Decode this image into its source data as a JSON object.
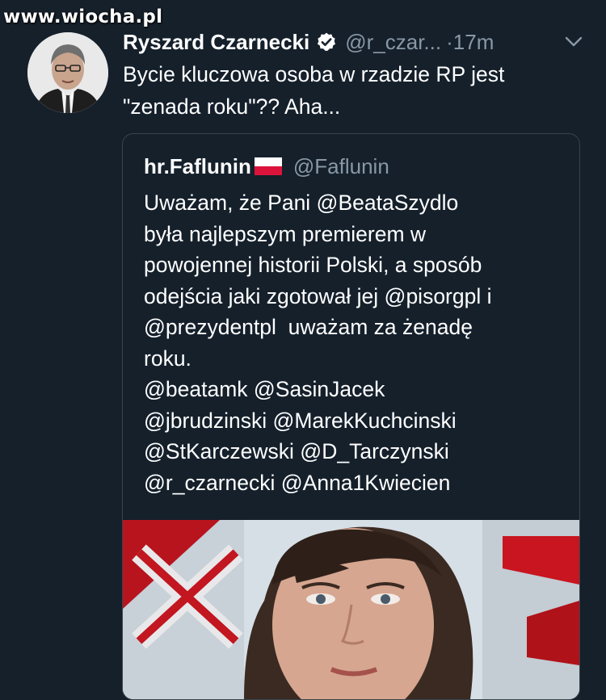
{
  "watermark": "www.wiocha.pl",
  "tweet": {
    "author_name": "Ryszard Czarnecki",
    "handle": "@r_czar...",
    "separator": "·",
    "time": "17m",
    "text_lines": [
      "Bycie kluczowa osoba w rzadzie RP jest",
      "\"zenada roku\"?? Aha..."
    ]
  },
  "quoted": {
    "name": "hr.Faflunin",
    "handle": "@Faflunin",
    "text_lines": [
      "Uważam, że Pani @BeataSzydlo",
      "była najlepszym premierem w",
      "powojennej historii Polski, a sposób",
      "odejścia jaki zgotował jej @pisorgpl i",
      "@prezydentpl  uważam za żenadę",
      "roku.",
      "@beatamk @SasinJacek",
      "@jbrudzinski @MarekKuchcinski",
      "@StKarczewski @D_Tarczynski",
      "@r_czarnecki @Anna1Kwiecien"
    ]
  },
  "icons": {
    "verified": "verified-badge-icon",
    "caret": "chevron-down-icon",
    "flag": "poland-flag-icon"
  },
  "colors": {
    "background": "#15202b",
    "secondary_text": "#8899a6",
    "card_border": "#38444d"
  }
}
